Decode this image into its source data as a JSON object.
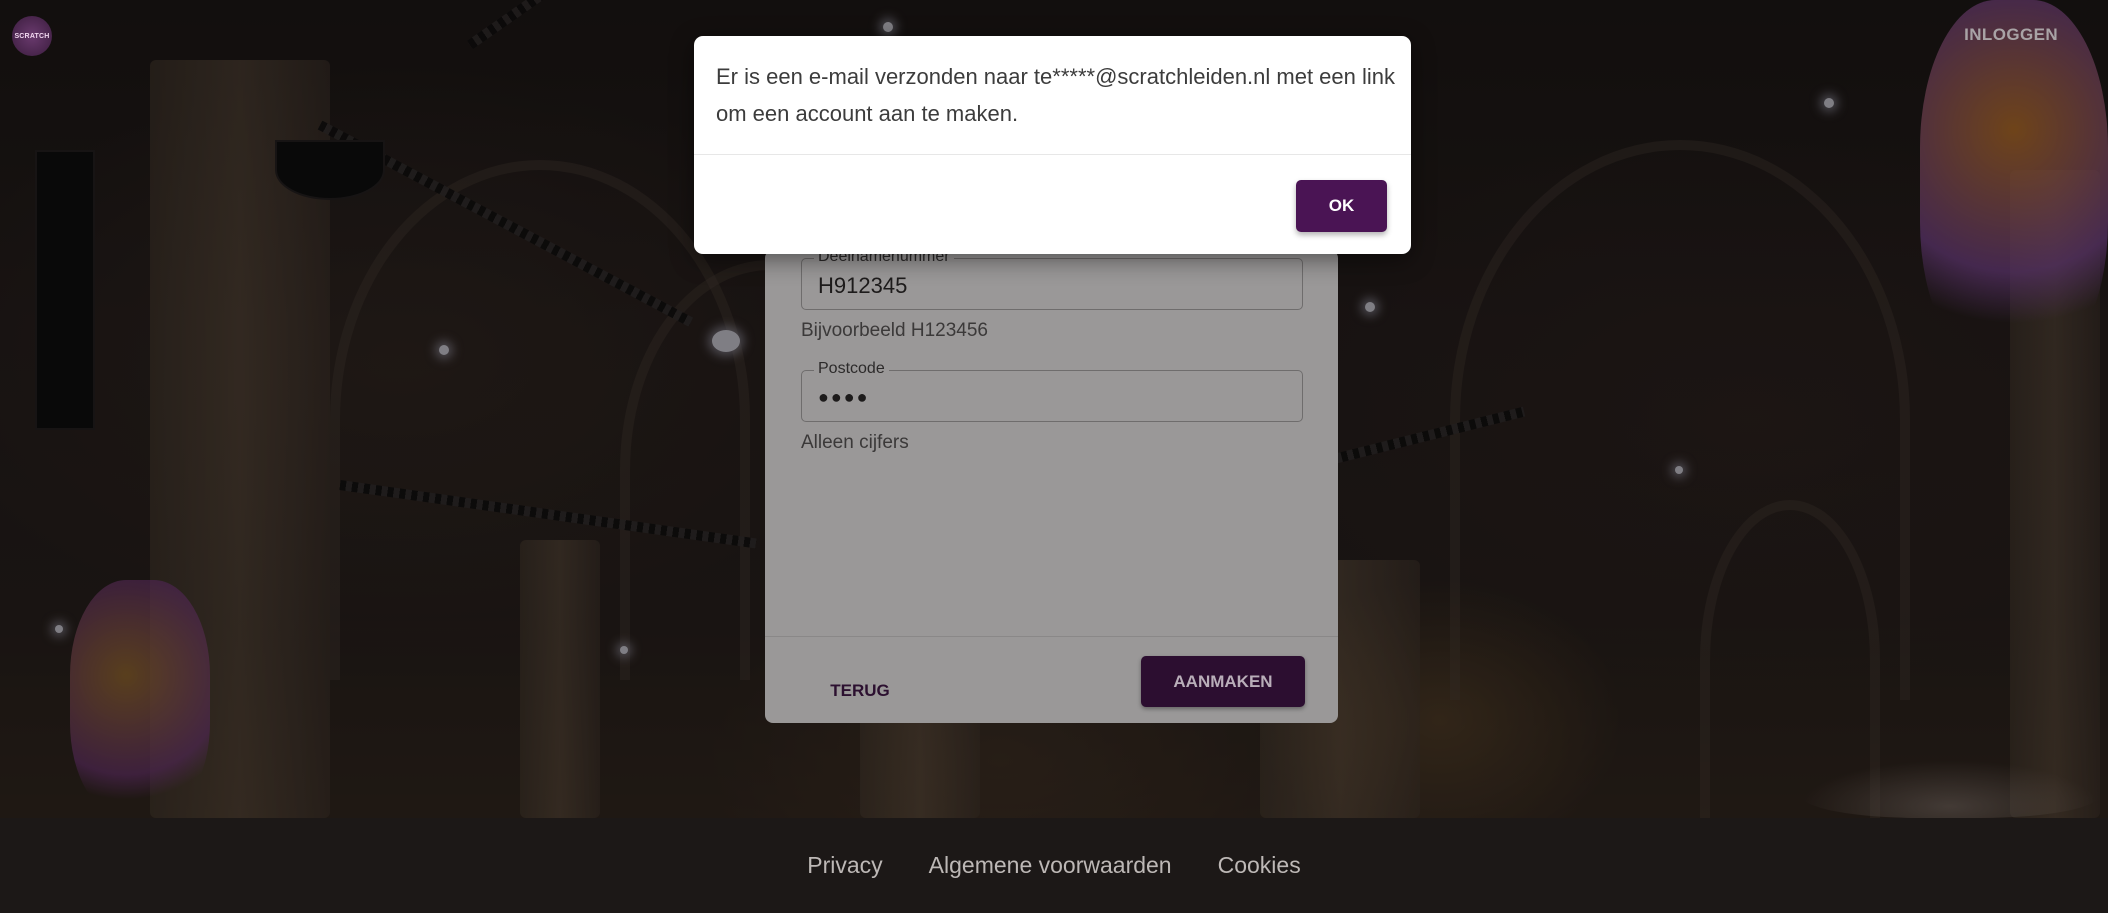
{
  "header": {
    "logo_text": "SCRATCH",
    "login_label": "INLOGGEN"
  },
  "form": {
    "participant_number": {
      "label": "Deelnamenummer",
      "value": "H912345",
      "helper": "Bijvoorbeeld H123456"
    },
    "postcode": {
      "label": "Postcode",
      "value": "●●●●",
      "helper": "Alleen cijfers"
    },
    "back_label": "TERUG",
    "create_label": "AANMAKEN"
  },
  "dialog": {
    "message": "Er is een e-mail verzonden naar te*****@scratchleiden.nl met een link om een account aan te maken.",
    "ok_label": "OK"
  },
  "footer": {
    "links": [
      "Privacy",
      "Algemene voorwaarden",
      "Cookies"
    ]
  },
  "colors": {
    "primary": "#4a1454",
    "footer_bg": "#1c1817"
  }
}
